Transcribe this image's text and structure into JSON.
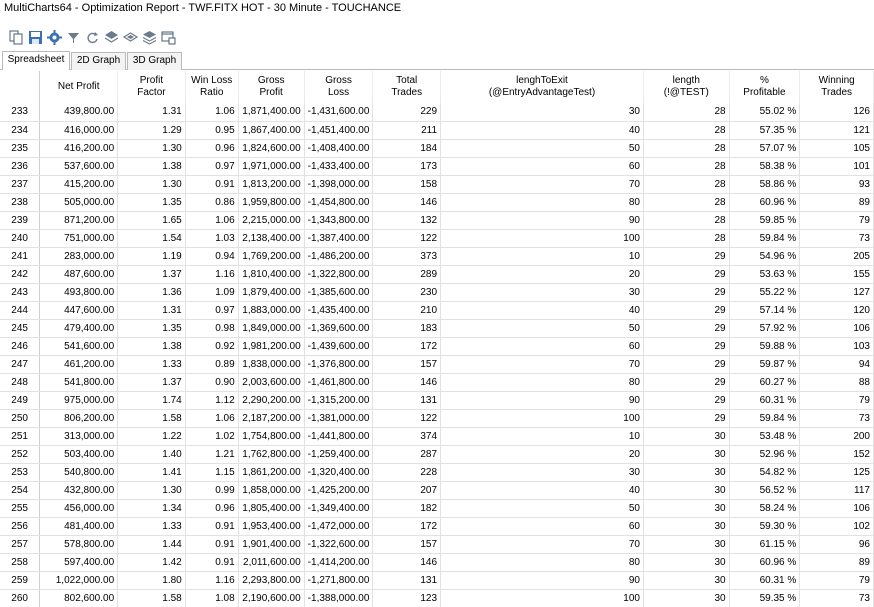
{
  "window": {
    "title": "MultiCharts64 - Optimization Report - TWF.FITX HOT - 30 Minute - TOUCHANCE"
  },
  "toolbar": {
    "icons": [
      "copy-icon",
      "save-icon",
      "settings-gear-icon",
      "filter-icon",
      "refresh-icon",
      "layers-icon",
      "layers-flat-icon",
      "layers-stack-icon",
      "window-export-icon"
    ]
  },
  "tabs": [
    {
      "label": "Spreadsheet",
      "active": true
    },
    {
      "label": "2D Graph",
      "active": false
    },
    {
      "label": "3D Graph",
      "active": false
    }
  ],
  "table": {
    "columns": [
      "",
      "Net Profit",
      "Profit\nFactor",
      "Win Loss\nRatio",
      "Gross\nProfit",
      "Gross\nLoss",
      "Total\nTrades",
      "lenghToExit\n(@EntryAdvantageTest)",
      "length\n(!@TEST)",
      "%\nProfitable",
      "Winning\nTrades"
    ],
    "rows": [
      [
        "233",
        "439,800.00",
        "1.31",
        "1.06",
        "1,871,400.00",
        "-1,431,600.00",
        "229",
        "30",
        "28",
        "55.02 %",
        "126"
      ],
      [
        "234",
        "416,000.00",
        "1.29",
        "0.95",
        "1,867,400.00",
        "-1,451,400.00",
        "211",
        "40",
        "28",
        "57.35 %",
        "121"
      ],
      [
        "235",
        "416,200.00",
        "1.30",
        "0.96",
        "1,824,600.00",
        "-1,408,400.00",
        "184",
        "50",
        "28",
        "57.07 %",
        "105"
      ],
      [
        "236",
        "537,600.00",
        "1.38",
        "0.97",
        "1,971,000.00",
        "-1,433,400.00",
        "173",
        "60",
        "28",
        "58.38 %",
        "101"
      ],
      [
        "237",
        "415,200.00",
        "1.30",
        "0.91",
        "1,813,200.00",
        "-1,398,000.00",
        "158",
        "70",
        "28",
        "58.86 %",
        "93"
      ],
      [
        "238",
        "505,000.00",
        "1.35",
        "0.86",
        "1,959,800.00",
        "-1,454,800.00",
        "146",
        "80",
        "28",
        "60.96 %",
        "89"
      ],
      [
        "239",
        "871,200.00",
        "1.65",
        "1.06",
        "2,215,000.00",
        "-1,343,800.00",
        "132",
        "90",
        "28",
        "59.85 %",
        "79"
      ],
      [
        "240",
        "751,000.00",
        "1.54",
        "1.03",
        "2,138,400.00",
        "-1,387,400.00",
        "122",
        "100",
        "28",
        "59.84 %",
        "73"
      ],
      [
        "241",
        "283,000.00",
        "1.19",
        "0.94",
        "1,769,200.00",
        "-1,486,200.00",
        "373",
        "10",
        "29",
        "54.96 %",
        "205"
      ],
      [
        "242",
        "487,600.00",
        "1.37",
        "1.16",
        "1,810,400.00",
        "-1,322,800.00",
        "289",
        "20",
        "29",
        "53.63 %",
        "155"
      ],
      [
        "243",
        "493,800.00",
        "1.36",
        "1.09",
        "1,879,400.00",
        "-1,385,600.00",
        "230",
        "30",
        "29",
        "55.22 %",
        "127"
      ],
      [
        "244",
        "447,600.00",
        "1.31",
        "0.97",
        "1,883,000.00",
        "-1,435,400.00",
        "210",
        "40",
        "29",
        "57.14 %",
        "120"
      ],
      [
        "245",
        "479,400.00",
        "1.35",
        "0.98",
        "1,849,000.00",
        "-1,369,600.00",
        "183",
        "50",
        "29",
        "57.92 %",
        "106"
      ],
      [
        "246",
        "541,600.00",
        "1.38",
        "0.92",
        "1,981,200.00",
        "-1,439,600.00",
        "172",
        "60",
        "29",
        "59.88 %",
        "103"
      ],
      [
        "247",
        "461,200.00",
        "1.33",
        "0.89",
        "1,838,000.00",
        "-1,376,800.00",
        "157",
        "70",
        "29",
        "59.87 %",
        "94"
      ],
      [
        "248",
        "541,800.00",
        "1.37",
        "0.90",
        "2,003,600.00",
        "-1,461,800.00",
        "146",
        "80",
        "29",
        "60.27 %",
        "88"
      ],
      [
        "249",
        "975,000.00",
        "1.74",
        "1.12",
        "2,290,200.00",
        "-1,315,200.00",
        "131",
        "90",
        "29",
        "60.31 %",
        "79"
      ],
      [
        "250",
        "806,200.00",
        "1.58",
        "1.06",
        "2,187,200.00",
        "-1,381,000.00",
        "122",
        "100",
        "29",
        "59.84 %",
        "73"
      ],
      [
        "251",
        "313,000.00",
        "1.22",
        "1.02",
        "1,754,800.00",
        "-1,441,800.00",
        "374",
        "10",
        "30",
        "53.48 %",
        "200"
      ],
      [
        "252",
        "503,400.00",
        "1.40",
        "1.21",
        "1,762,800.00",
        "-1,259,400.00",
        "287",
        "20",
        "30",
        "52.96 %",
        "152"
      ],
      [
        "253",
        "540,800.00",
        "1.41",
        "1.15",
        "1,861,200.00",
        "-1,320,400.00",
        "228",
        "30",
        "30",
        "54.82 %",
        "125"
      ],
      [
        "254",
        "432,800.00",
        "1.30",
        "0.99",
        "1,858,000.00",
        "-1,425,200.00",
        "207",
        "40",
        "30",
        "56.52 %",
        "117"
      ],
      [
        "255",
        "456,000.00",
        "1.34",
        "0.96",
        "1,805,400.00",
        "-1,349,400.00",
        "182",
        "50",
        "30",
        "58.24 %",
        "106"
      ],
      [
        "256",
        "481,400.00",
        "1.33",
        "0.91",
        "1,953,400.00",
        "-1,472,000.00",
        "172",
        "60",
        "30",
        "59.30 %",
        "102"
      ],
      [
        "257",
        "578,800.00",
        "1.44",
        "0.91",
        "1,901,400.00",
        "-1,322,600.00",
        "157",
        "70",
        "30",
        "61.15 %",
        "96"
      ],
      [
        "258",
        "597,400.00",
        "1.42",
        "0.91",
        "2,011,600.00",
        "-1,414,200.00",
        "146",
        "80",
        "30",
        "60.96 %",
        "89"
      ],
      [
        "259",
        "1,022,000.00",
        "1.80",
        "1.16",
        "2,293,800.00",
        "-1,271,800.00",
        "131",
        "90",
        "30",
        "60.31 %",
        "79"
      ],
      [
        "260",
        "802,600.00",
        "1.58",
        "1.08",
        "2,190,600.00",
        "-1,388,000.00",
        "123",
        "100",
        "30",
        "59.35 %",
        "73"
      ]
    ]
  }
}
